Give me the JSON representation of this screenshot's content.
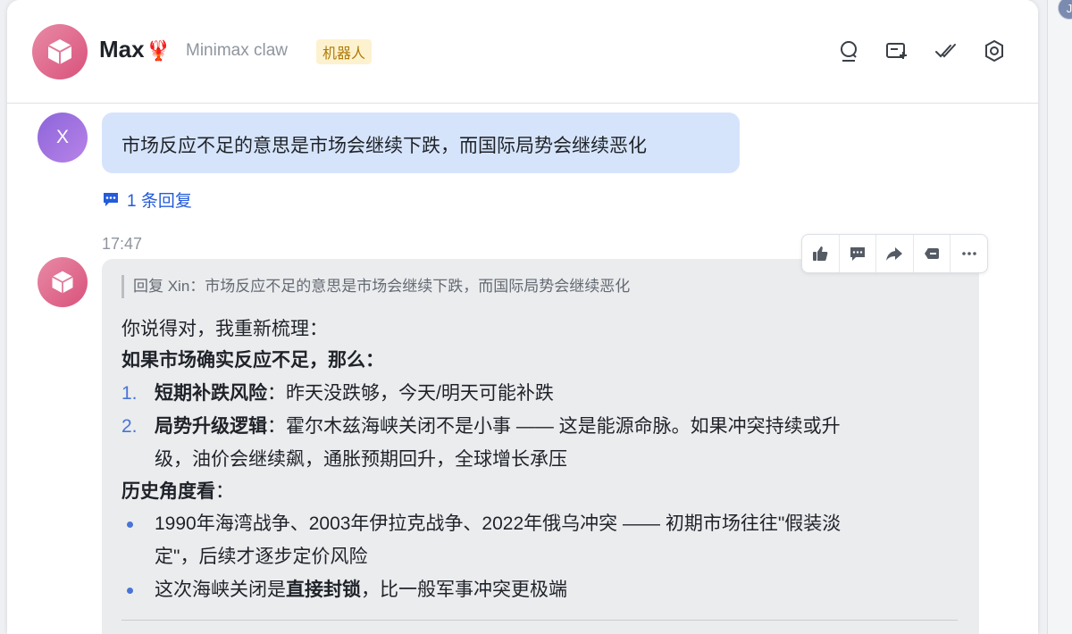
{
  "header": {
    "bot_name": "Max",
    "bot_name_emoji": "🦞",
    "subtitle": "Minimax claw",
    "badge": "机器人",
    "icons": [
      "search-icon",
      "new-topic-icon",
      "mark-done-icon",
      "settings-icon"
    ]
  },
  "corner_avatar_initial": "J",
  "messages": {
    "user": {
      "avatar_initial": "X",
      "text": "市场反应不足的意思是市场会继续下跌，而国际局势会继续恶化",
      "reply_count_label": "1 条回复"
    },
    "bot": {
      "time": "17:47",
      "quote": "回复 Xin：市场反应不足的意思是市场会继续下跌，而国际局势会继续恶化",
      "intro": "你说得对，我重新梳理：",
      "heading1": "如果市场确实反应不足，那么：",
      "list1": [
        {
          "num": "1.",
          "bold": "短期补跌风险",
          "rest": "：昨天没跌够，今天/明天可能补跌"
        },
        {
          "num": "2.",
          "bold": "局势升级逻辑",
          "rest": "：霍尔木兹海峡关闭不是小事 —— 这是能源命脉。如果冲突持续或升",
          "cont": "级，油价会继续飙，通胀预期回升，全球增长承压"
        }
      ],
      "heading2": "历史角度看",
      "heading2_colon": "：",
      "list2": [
        {
          "text": "1990年海湾战争、2003年伊拉克战争、2022年俄乌冲突 —— 初期市场往往\"假装淡",
          "cont": "定\"，后续才逐步定价风险"
        },
        {
          "pre": "这次海峡关闭是",
          "bold": "直接封锁",
          "post": "，比一般军事冲突更极端"
        }
      ]
    }
  },
  "toolbar": {
    "icons": [
      "thumbs-up-icon",
      "comment-icon",
      "forward-icon",
      "quote-reply-icon",
      "more-icon"
    ]
  },
  "colors": {
    "accent_blue": "#245bdb",
    "user_bubble": "#d6e4fb",
    "bot_bubble": "#ebecee",
    "badge_bg": "#fdf2cf",
    "badge_text": "#b07a06"
  }
}
